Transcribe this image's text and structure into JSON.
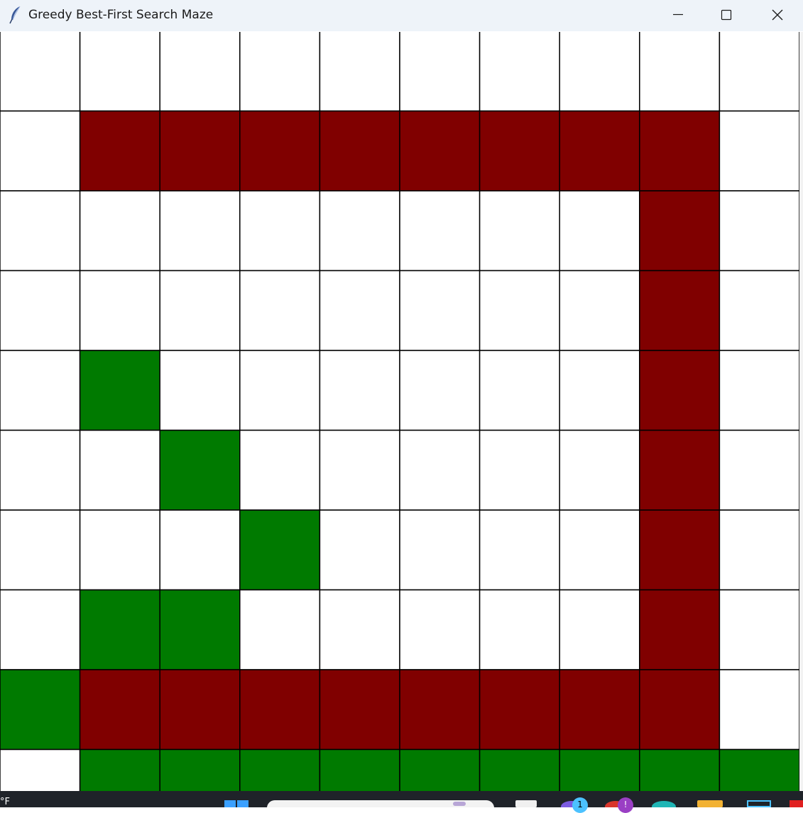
{
  "window": {
    "title": "Greedy Best-First Search Maze",
    "controls": {
      "minimize": "minimize-icon",
      "maximize": "maximize-icon",
      "close": "close-icon"
    }
  },
  "maze": {
    "rows": 10,
    "cols": 10,
    "legend_codes": {
      "0": "open",
      "1": "wall",
      "2": "path"
    },
    "colors": {
      "open": "#ffffff",
      "wall": "#800000",
      "path": "#007a00",
      "grid_line": "#000000"
    },
    "grid": [
      [
        0,
        0,
        0,
        0,
        0,
        0,
        0,
        0,
        0,
        0
      ],
      [
        0,
        1,
        1,
        1,
        1,
        1,
        1,
        1,
        1,
        0
      ],
      [
        0,
        0,
        0,
        0,
        0,
        0,
        0,
        0,
        1,
        0
      ],
      [
        0,
        0,
        0,
        0,
        0,
        0,
        0,
        0,
        1,
        0
      ],
      [
        0,
        2,
        0,
        0,
        0,
        0,
        0,
        0,
        1,
        0
      ],
      [
        0,
        0,
        2,
        0,
        0,
        0,
        0,
        0,
        1,
        0
      ],
      [
        0,
        0,
        0,
        2,
        0,
        0,
        0,
        0,
        1,
        0
      ],
      [
        0,
        2,
        2,
        0,
        0,
        0,
        0,
        0,
        1,
        0
      ],
      [
        2,
        1,
        1,
        1,
        1,
        1,
        1,
        1,
        1,
        0
      ],
      [
        0,
        2,
        2,
        2,
        2,
        2,
        2,
        2,
        2,
        2
      ]
    ]
  },
  "taskbar": {
    "clock_fragment": "°F",
    "badges": [
      "1",
      "!"
    ],
    "icons": [
      "windows-start-icon",
      "search-box",
      "app-icon-1",
      "app-icon-2",
      "app-icon-3",
      "app-icon-4",
      "folder-icon",
      "app-icon-6",
      "app-icon-7"
    ]
  }
}
